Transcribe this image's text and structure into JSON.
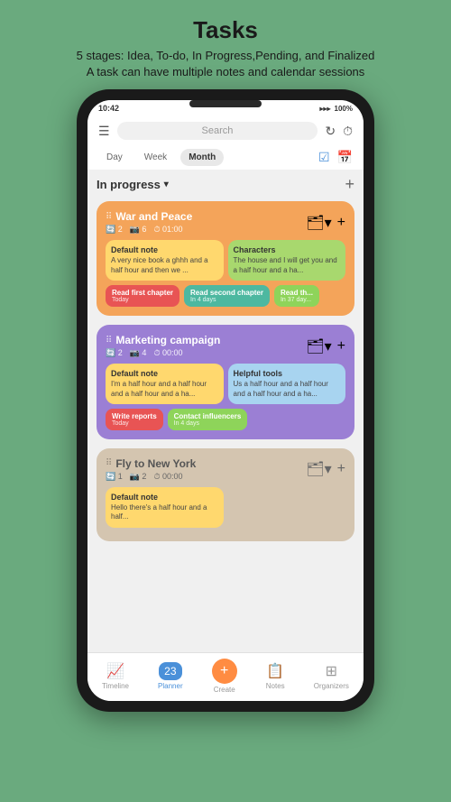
{
  "header": {
    "title": "Tasks",
    "subtitle1": "5 stages: Idea, To-do, In Progress,Pending, and Finalized",
    "subtitle2": "A task can have multiple notes and calendar sessions"
  },
  "statusBar": {
    "time": "10:42",
    "battery": "100%"
  },
  "topBar": {
    "searchPlaceholder": "Search",
    "menuIcon": "☰",
    "refreshIcon": "↻",
    "timerIcon": "⏱"
  },
  "tabs": {
    "day": "Day",
    "week": "Week",
    "month": "Month"
  },
  "section": {
    "title": "In progress",
    "addIcon": "+"
  },
  "tasks": [
    {
      "id": "war-peace",
      "title": "War and Peace",
      "color": "orange",
      "meta": {
        "notes": "2",
        "sessions": "6",
        "duration": "01:00"
      },
      "notes": [
        {
          "title": "Default note",
          "text": "A very nice book a ghhh and a half hour and then we ...",
          "color": "yellow"
        },
        {
          "title": "Characters",
          "text": "The house and I will get you and a half hour and a ha...",
          "color": "green"
        }
      ],
      "sessions": [
        {
          "title": "Read first chapter",
          "sub": "Today",
          "color": "red"
        },
        {
          "title": "Read second chapter",
          "sub": "In 4 days",
          "color": "teal"
        },
        {
          "title": "Read th...",
          "sub": "In 37 day...",
          "color": "light-green"
        }
      ]
    },
    {
      "id": "marketing",
      "title": "Marketing campaign",
      "color": "purple",
      "meta": {
        "notes": "2",
        "sessions": "4",
        "duration": "00:00"
      },
      "notes": [
        {
          "title": "Default note",
          "text": "I'm a half hour and a half hour and a half hour and a ha...",
          "color": "yellow"
        },
        {
          "title": "Helpful tools",
          "text": "Us a half hour and a half hour and a half hour and a ha...",
          "color": "light-blue"
        }
      ],
      "sessions": [
        {
          "title": "Write reports",
          "sub": "Today",
          "color": "red"
        },
        {
          "title": "Contact influencers",
          "sub": "In 4 days",
          "color": "light-green"
        }
      ]
    },
    {
      "id": "fly-new-york",
      "title": "Fly to New York",
      "color": "beige",
      "meta": {
        "notes": "1",
        "sessions": "2",
        "duration": "00:00"
      },
      "notes": [
        {
          "title": "Default note",
          "text": "Hello there's a half hour and a half...",
          "color": "yellow"
        }
      ],
      "sessions": []
    }
  ],
  "bottomNav": [
    {
      "id": "timeline",
      "label": "Timeline",
      "icon": "📈"
    },
    {
      "id": "planner",
      "label": "Planner",
      "icon": "📅",
      "active": true
    },
    {
      "id": "create",
      "label": "Create",
      "icon": "+"
    },
    {
      "id": "notes",
      "label": "Notes",
      "icon": "📋"
    },
    {
      "id": "organizers",
      "label": "Organizers",
      "icon": "⊞"
    }
  ],
  "colors": {
    "accent": "#4a90d9",
    "orange": "#f4a45a",
    "purple": "#9b7fd4",
    "beige": "#d4c5b0"
  }
}
